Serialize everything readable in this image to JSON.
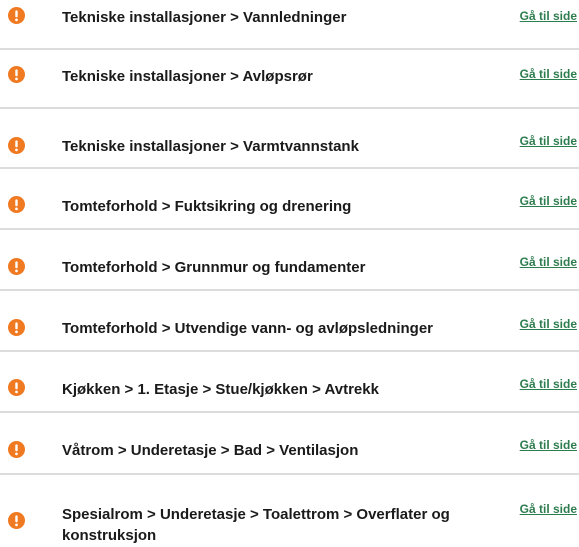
{
  "colors": {
    "warning_icon": "#f07a22",
    "link": "#2e7d4f",
    "divider": "#dcdcdc"
  },
  "items": [
    {
      "icon": "exclamation-warning-icon",
      "text": "Tekniske installasjoner > Vannledninger",
      "link": "Gå til side"
    },
    {
      "icon": "exclamation-warning-icon",
      "text": "Tekniske installasjoner > Avløpsrør",
      "link": "Gå til side"
    },
    {
      "icon": "exclamation-warning-icon",
      "text": "Tekniske installasjoner > Varmtvannstank",
      "link": "Gå til side"
    },
    {
      "icon": "exclamation-warning-icon",
      "text": "Tomteforhold > Fuktsikring og drenering",
      "link": "Gå til side"
    },
    {
      "icon": "exclamation-warning-icon",
      "text": "Tomteforhold > Grunnmur og fundamenter",
      "link": "Gå til side"
    },
    {
      "icon": "exclamation-warning-icon",
      "text": "Tomteforhold > Utvendige vann- og avløpsledninger",
      "link": "Gå til side"
    },
    {
      "icon": "exclamation-warning-icon",
      "text": "Kjøkken > 1. Etasje > Stue/kjøkken  > Avtrekk",
      "link": "Gå til side"
    },
    {
      "icon": "exclamation-warning-icon",
      "text": "Våtrom > Underetasje > Bad  > Ventilasjon",
      "link": "Gå til side"
    },
    {
      "icon": "exclamation-warning-icon",
      "text": "Spesialrom > Underetasje > Toalettrom  > Overflater og konstruksjon",
      "link": "Gå til side"
    }
  ]
}
